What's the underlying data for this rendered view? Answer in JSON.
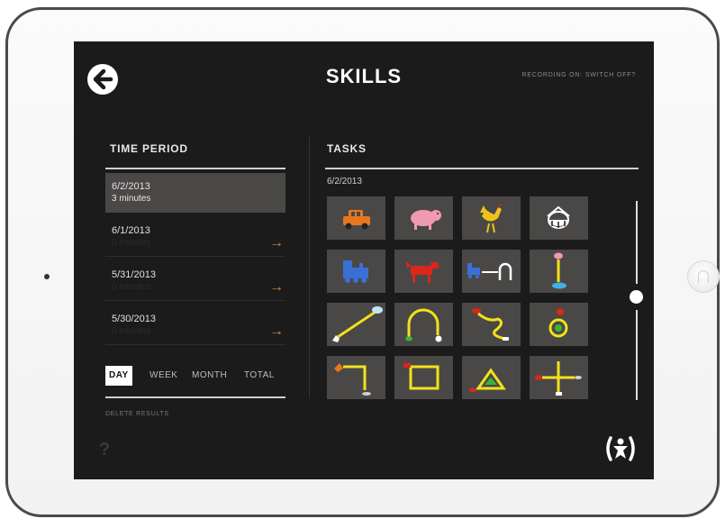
{
  "header": {
    "title": "SKILLS",
    "recording": "RECORDING ON: SWITCH OFF?"
  },
  "time_period": {
    "title": "TIME PERIOD",
    "periods": [
      {
        "date": "6/2/2013",
        "duration": "3 minutes",
        "selected": true
      },
      {
        "date": "6/1/2013",
        "duration": "0 minutes",
        "selected": false
      },
      {
        "date": "5/31/2013",
        "duration": "0 minutes",
        "selected": false
      },
      {
        "date": "5/30/2013",
        "duration": "0 minutes",
        "selected": false
      }
    ],
    "arrow_glyph": "→",
    "tabs": [
      "DAY",
      "WEEK",
      "MONTH",
      "TOTAL"
    ],
    "active_tab": "DAY",
    "delete_label": "DELETE RESULTS",
    "help_glyph": "?"
  },
  "tasks": {
    "title": "TASKS",
    "date": "6/2/2013",
    "items": [
      {
        "icon": "car-icon"
      },
      {
        "icon": "pig-icon"
      },
      {
        "icon": "rooster-icon"
      },
      {
        "icon": "drum-icon"
      },
      {
        "icon": "train-icon"
      },
      {
        "icon": "dog-icon"
      },
      {
        "icon": "train-to-arch-icon"
      },
      {
        "icon": "pig-to-puddle-icon"
      },
      {
        "icon": "cat-to-cloud-icon"
      },
      {
        "icon": "frog-arch-icon"
      },
      {
        "icon": "ant-path-icon"
      },
      {
        "icon": "ladybug-ring-icon"
      },
      {
        "icon": "rooster-corner-path-icon"
      },
      {
        "icon": "rectangle-path-icon"
      },
      {
        "icon": "triangle-path-icon"
      },
      {
        "icon": "cross-path-icon"
      }
    ]
  },
  "colors": {
    "screen_bg": "#1b1b1b",
    "tile_bg": "#4a4847",
    "accent_orange": "#d78639",
    "path_yellow": "#f2e21a",
    "animal_red": "#d8271c"
  }
}
